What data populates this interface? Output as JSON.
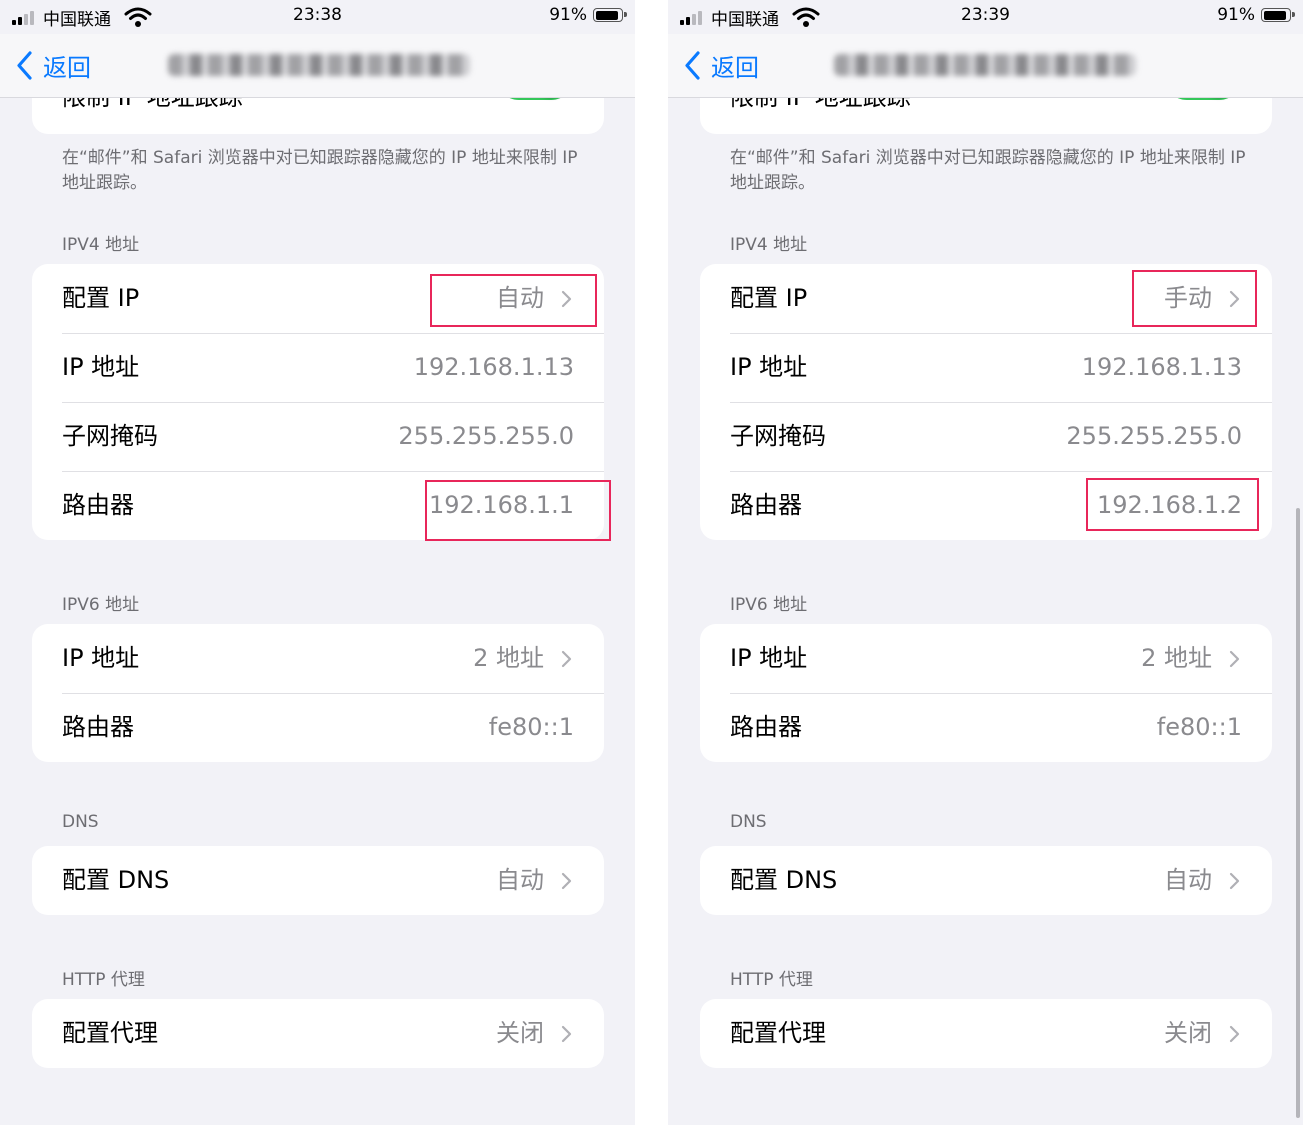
{
  "screens": [
    {
      "status": {
        "carrier": "中国联通",
        "time": "23:38",
        "battery": "91%"
      },
      "nav": {
        "back_label": "返回"
      },
      "limit_ip": {
        "label": "限制 IP 地址跟踪",
        "on": true,
        "footer": "在“邮件”和 Safari 浏览器中对已知跟踪器隐藏您的 IP 地址来限制 IP 地址跟踪。"
      },
      "ipv4": {
        "header": "IPV4 地址",
        "configure_label": "配置 IP",
        "configure_value": "自动",
        "ip_label": "IP 地址",
        "ip_value": "192.168.1.13",
        "mask_label": "子网掩码",
        "mask_value": "255.255.255.0",
        "router_label": "路由器",
        "router_value": "192.168.1.1"
      },
      "ipv6": {
        "header": "IPV6 地址",
        "ip_label": "IP 地址",
        "ip_value": "2 地址",
        "router_label": "路由器",
        "router_value": "fe80::1"
      },
      "dns": {
        "header": "DNS",
        "label": "配置 DNS",
        "value": "自动"
      },
      "proxy": {
        "header": "HTTP 代理",
        "label": "配置代理",
        "value": "关闭"
      }
    },
    {
      "status": {
        "carrier": "中国联通",
        "time": "23:39",
        "battery": "91%"
      },
      "nav": {
        "back_label": "返回"
      },
      "limit_ip": {
        "label": "限制 IP 地址跟踪",
        "on": true,
        "footer": "在“邮件”和 Safari 浏览器中对已知跟踪器隐藏您的 IP 地址来限制 IP 地址跟踪。"
      },
      "ipv4": {
        "header": "IPV4 地址",
        "configure_label": "配置 IP",
        "configure_value": "手动",
        "ip_label": "IP 地址",
        "ip_value": "192.168.1.13",
        "mask_label": "子网掩码",
        "mask_value": "255.255.255.0",
        "router_label": "路由器",
        "router_value": "192.168.1.2"
      },
      "ipv6": {
        "header": "IPV6 地址",
        "ip_label": "IP 地址",
        "ip_value": "2 地址",
        "router_label": "路由器",
        "router_value": "fe80::1"
      },
      "dns": {
        "header": "DNS",
        "label": "配置 DNS",
        "value": "自动"
      },
      "proxy": {
        "header": "HTTP 代理",
        "label": "配置代理",
        "value": "关闭"
      }
    }
  ],
  "colors": {
    "accent": "#0a7aff",
    "toggle_on": "#34c759",
    "highlight": "#e8265a",
    "background": "#f2f2f7"
  }
}
